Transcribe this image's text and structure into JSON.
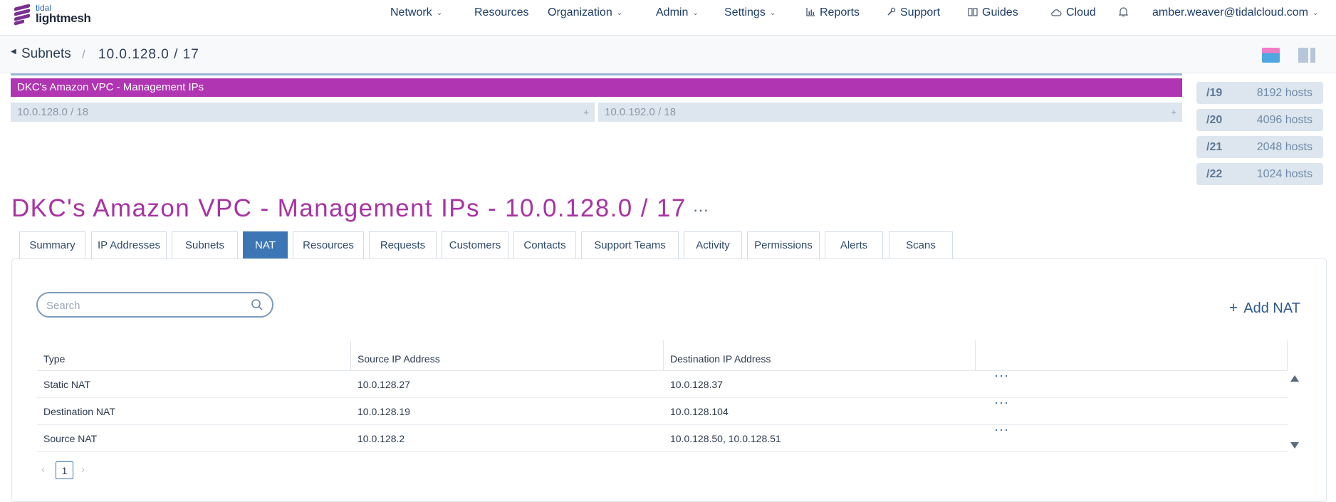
{
  "brand": {
    "small": "tidal",
    "name": "lightmesh"
  },
  "nav": {
    "items": [
      {
        "label": "Network",
        "has_caret": true
      },
      {
        "label": "Resources"
      },
      {
        "label": "Organization",
        "has_caret": true
      },
      {
        "label": "Admin",
        "has_caret": true
      },
      {
        "label": "Settings",
        "has_caret": true
      },
      {
        "label": "Reports",
        "icon": "bar-chart-icon"
      },
      {
        "label": "Support",
        "icon": "wrench-icon"
      },
      {
        "label": "Guides",
        "icon": "book-icon"
      },
      {
        "label": "Cloud",
        "icon": "cloud-icon"
      }
    ],
    "notifications_icon": "bell-icon",
    "user": "amber.weaver@tidalcloud.com"
  },
  "breadcrumb": {
    "parent": "Subnets",
    "current": "10.0.128.0 / 17"
  },
  "subnet_map": {
    "main_bar": "DKC's Amazon VPC - Management IPs",
    "children": [
      {
        "label": "10.0.128.0 / 18",
        "action": "+"
      },
      {
        "label": "10.0.192.0 / 18",
        "action": "+"
      }
    ],
    "host_sizes": [
      {
        "prefix": "/19",
        "hosts": "8192 hosts"
      },
      {
        "prefix": "/20",
        "hosts": "4096 hosts"
      },
      {
        "prefix": "/21",
        "hosts": "2048 hosts"
      },
      {
        "prefix": "/22",
        "hosts": "1024 hosts"
      }
    ],
    "accent_color": "#b035b2"
  },
  "page": {
    "title": "DKC's Amazon VPC - Management IPs - 10.0.128.0 / 17",
    "more": "···"
  },
  "tabs": [
    {
      "label": "Summary"
    },
    {
      "label": "IP Addresses"
    },
    {
      "label": "Subnets"
    },
    {
      "label": "NAT",
      "active": true
    },
    {
      "label": "Resources"
    },
    {
      "label": "Requests"
    },
    {
      "label": "Customers"
    },
    {
      "label": "Contacts"
    },
    {
      "label": "Support Teams"
    },
    {
      "label": "Activity"
    },
    {
      "label": "Permissions"
    },
    {
      "label": "Alerts"
    },
    {
      "label": "Scans"
    }
  ],
  "nat": {
    "search_placeholder": "Search",
    "add_label": "Add NAT",
    "columns": [
      "Type",
      "Source IP Address",
      "Destination IP Address"
    ],
    "rows": [
      {
        "type": "Static NAT",
        "source": "10.0.128.27",
        "destination": "10.0.128.37",
        "more": "···"
      },
      {
        "type": "Destination NAT",
        "source": "10.0.128.19",
        "destination": "10.0.128.104",
        "more": "···"
      },
      {
        "type": "Source NAT",
        "source": "10.0.128.2",
        "destination": "10.0.128.50, 10.0.128.51",
        "more": "···"
      }
    ],
    "pagination": {
      "current_page": "1"
    }
  }
}
